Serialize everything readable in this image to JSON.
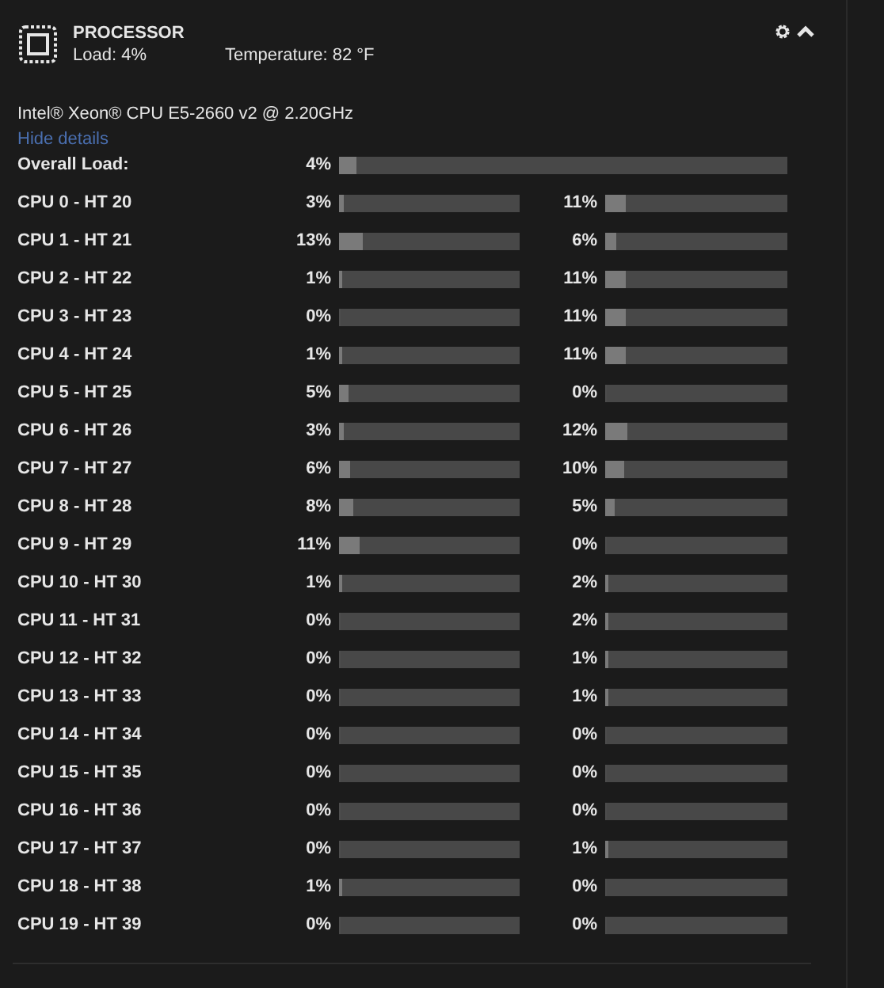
{
  "header": {
    "title": "PROCESSOR",
    "load": "Load: 4%",
    "temperature": "Temperature: 82 °F"
  },
  "cpu_model": "Intel® Xeon® CPU E5-2660 v2 @ 2.20GHz",
  "details_link": "Hide details",
  "overall": {
    "label": "Overall Load:",
    "reading": "4%",
    "level": 0.04
  },
  "cores": [
    {
      "name": "CPU 0 - HT 20",
      "cpu": {
        "reading": "3%",
        "level": 0.03
      },
      "ht": {
        "reading": "11%",
        "level": 0.11
      }
    },
    {
      "name": "CPU 1 - HT 21",
      "cpu": {
        "reading": "13%",
        "level": 0.13
      },
      "ht": {
        "reading": "6%",
        "level": 0.06
      }
    },
    {
      "name": "CPU 2 - HT 22",
      "cpu": {
        "reading": "1%",
        "level": 0.01
      },
      "ht": {
        "reading": "11%",
        "level": 0.11
      }
    },
    {
      "name": "CPU 3 - HT 23",
      "cpu": {
        "reading": "0%",
        "level": 0
      },
      "ht": {
        "reading": "11%",
        "level": 0.11
      }
    },
    {
      "name": "CPU 4 - HT 24",
      "cpu": {
        "reading": "1%",
        "level": 0.01
      },
      "ht": {
        "reading": "11%",
        "level": 0.11
      }
    },
    {
      "name": "CPU 5 - HT 25",
      "cpu": {
        "reading": "5%",
        "level": 0.05
      },
      "ht": {
        "reading": "0%",
        "level": 0
      }
    },
    {
      "name": "CPU 6 - HT 26",
      "cpu": {
        "reading": "3%",
        "level": 0.03
      },
      "ht": {
        "reading": "12%",
        "level": 0.12
      }
    },
    {
      "name": "CPU 7 - HT 27",
      "cpu": {
        "reading": "6%",
        "level": 0.06
      },
      "ht": {
        "reading": "10%",
        "level": 0.1
      }
    },
    {
      "name": "CPU 8 - HT 28",
      "cpu": {
        "reading": "8%",
        "level": 0.08
      },
      "ht": {
        "reading": "5%",
        "level": 0.05
      }
    },
    {
      "name": "CPU 9 - HT 29",
      "cpu": {
        "reading": "11%",
        "level": 0.11
      },
      "ht": {
        "reading": "0%",
        "level": 0
      }
    },
    {
      "name": "CPU 10 - HT 30",
      "cpu": {
        "reading": "1%",
        "level": 0.01
      },
      "ht": {
        "reading": "2%",
        "level": 0.02
      }
    },
    {
      "name": "CPU 11 - HT 31",
      "cpu": {
        "reading": "0%",
        "level": 0
      },
      "ht": {
        "reading": "2%",
        "level": 0.02
      }
    },
    {
      "name": "CPU 12 - HT 32",
      "cpu": {
        "reading": "0%",
        "level": 0
      },
      "ht": {
        "reading": "1%",
        "level": 0.01
      }
    },
    {
      "name": "CPU 13 - HT 33",
      "cpu": {
        "reading": "0%",
        "level": 0
      },
      "ht": {
        "reading": "1%",
        "level": 0.01
      }
    },
    {
      "name": "CPU 14 - HT 34",
      "cpu": {
        "reading": "0%",
        "level": 0
      },
      "ht": {
        "reading": "0%",
        "level": 0
      }
    },
    {
      "name": "CPU 15 - HT 35",
      "cpu": {
        "reading": "0%",
        "level": 0
      },
      "ht": {
        "reading": "0%",
        "level": 0
      }
    },
    {
      "name": "CPU 16 - HT 36",
      "cpu": {
        "reading": "0%",
        "level": 0
      },
      "ht": {
        "reading": "0%",
        "level": 0
      }
    },
    {
      "name": "CPU 17 - HT 37",
      "cpu": {
        "reading": "0%",
        "level": 0
      },
      "ht": {
        "reading": "1%",
        "level": 0.01
      }
    },
    {
      "name": "CPU 18 - HT 38",
      "cpu": {
        "reading": "1%",
        "level": 0.01
      },
      "ht": {
        "reading": "0%",
        "level": 0
      }
    },
    {
      "name": "CPU 19 - HT 39",
      "cpu": {
        "reading": "0%",
        "level": 0
      },
      "ht": {
        "reading": "0%",
        "level": 0
      }
    }
  ]
}
